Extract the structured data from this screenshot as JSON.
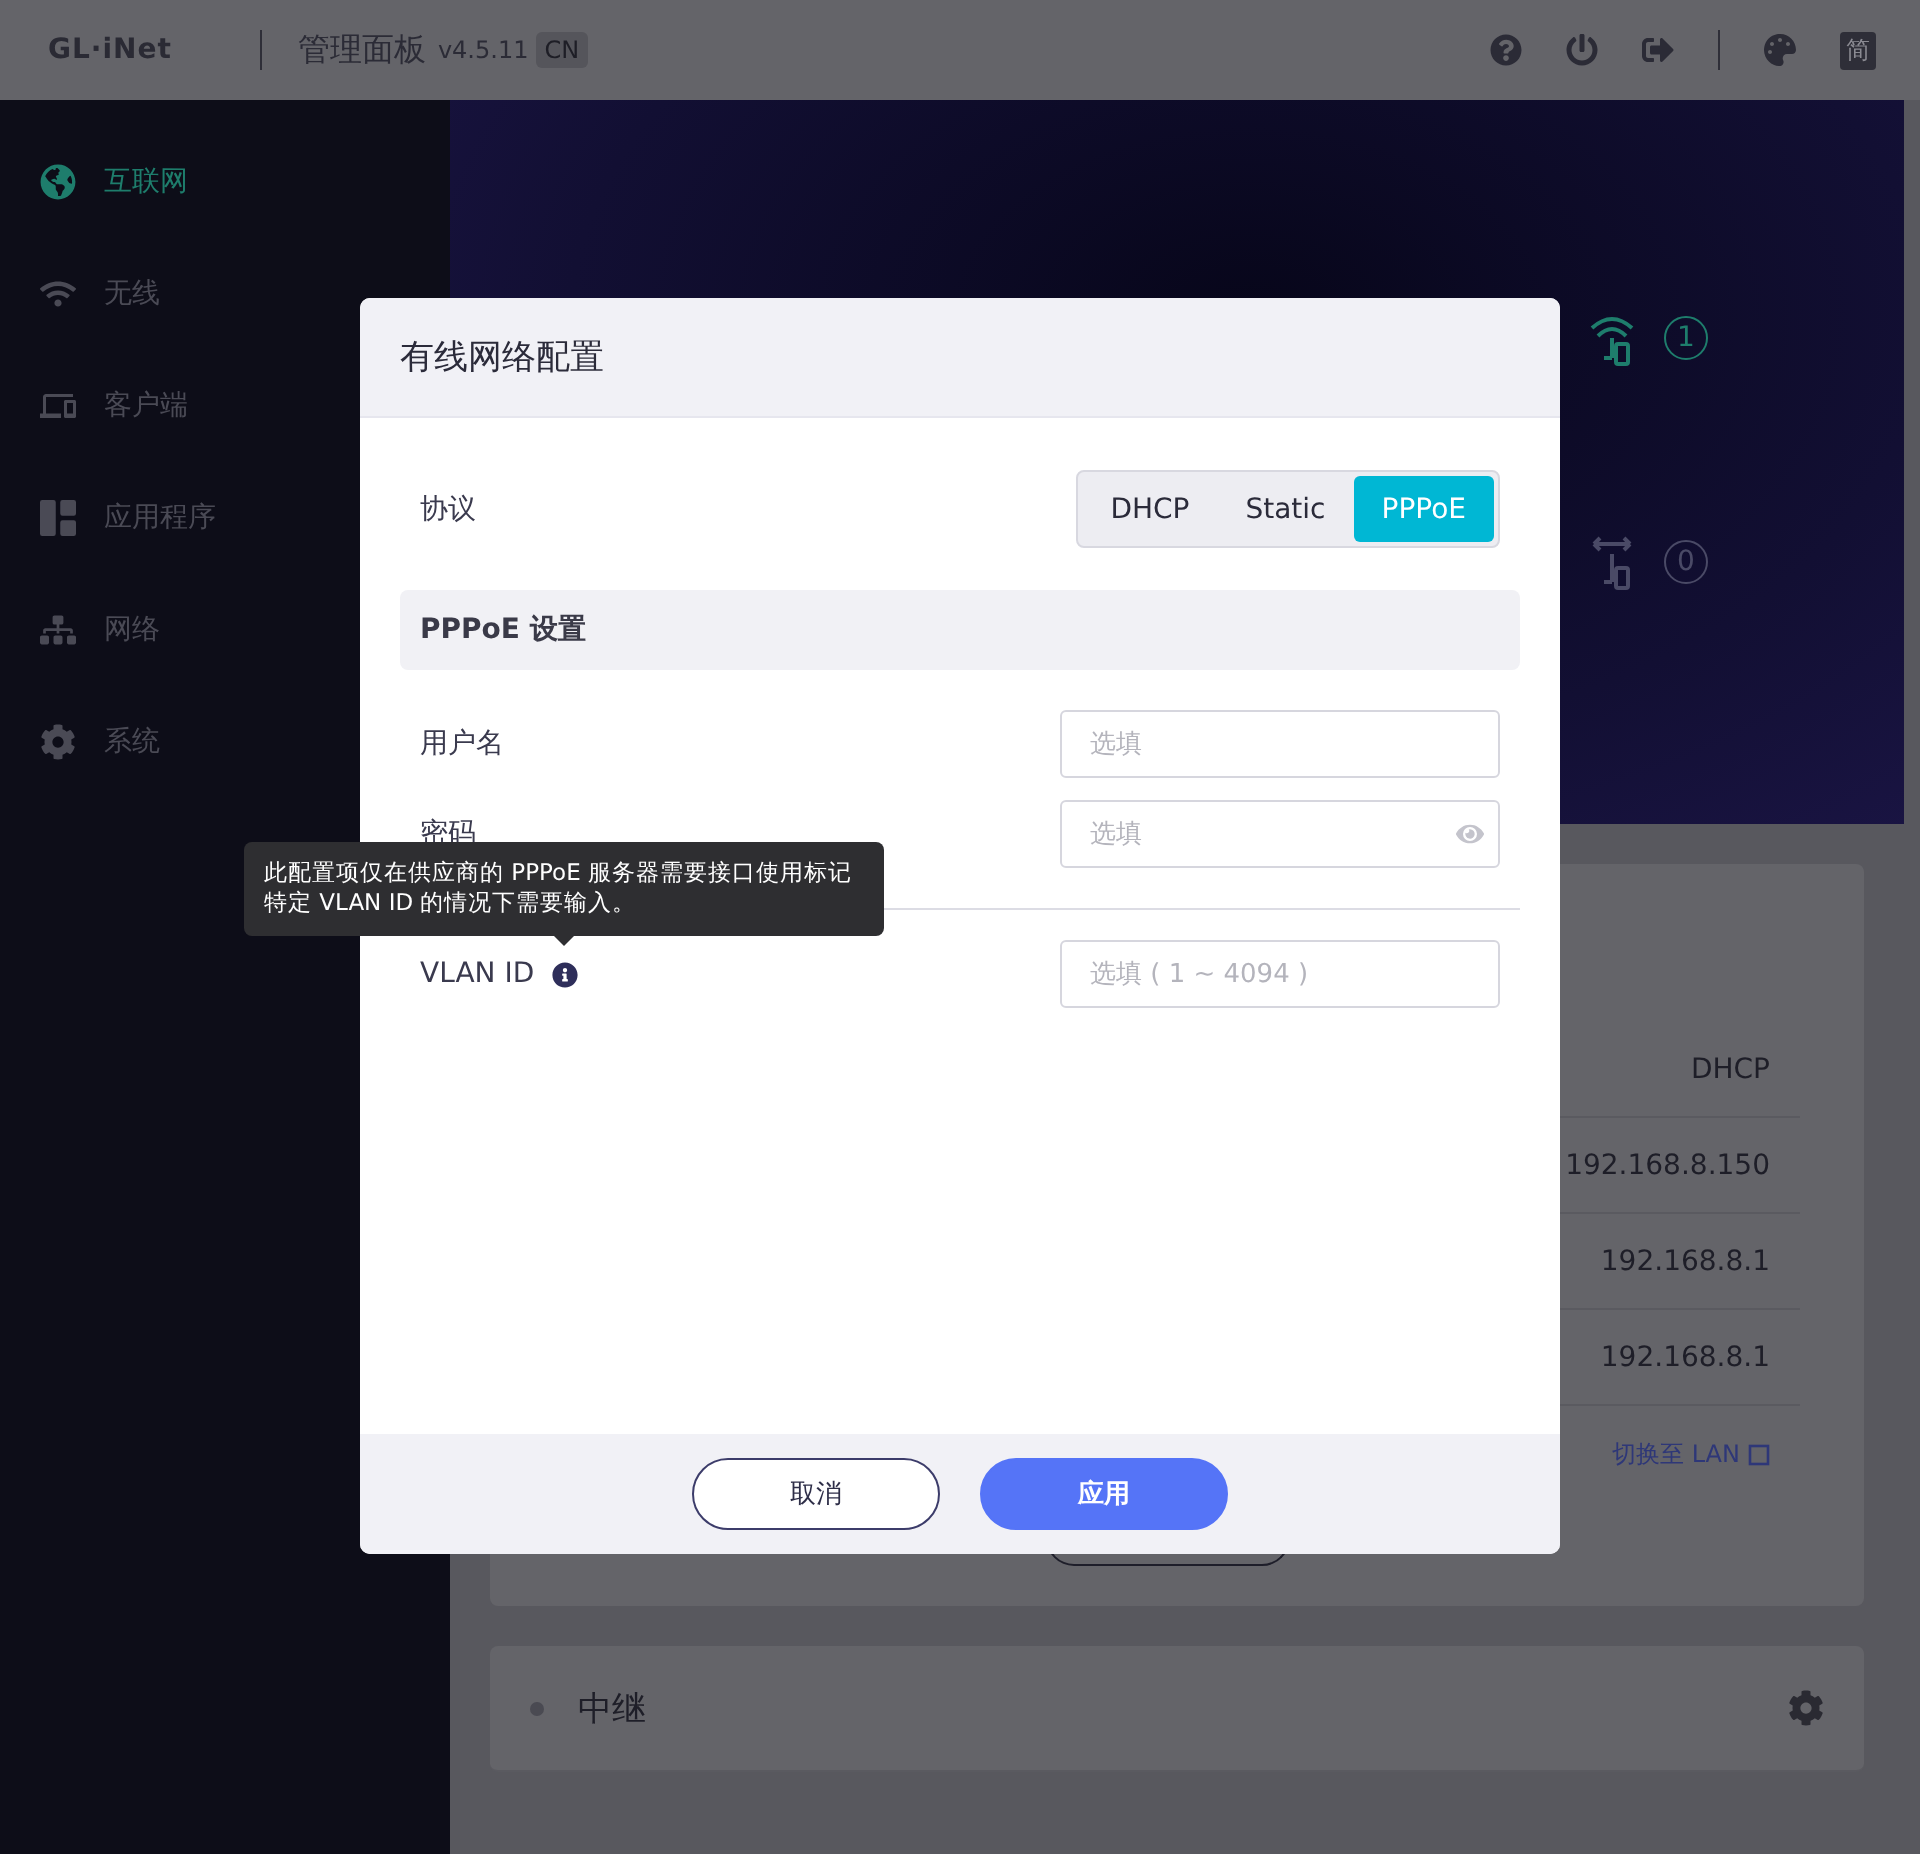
{
  "header": {
    "logo": "GL·iNet",
    "title": "管理面板",
    "version": "v4.5.11",
    "region": "CN",
    "language": "简"
  },
  "sidebar": {
    "items": [
      {
        "label": "互联网",
        "selected": true
      },
      {
        "label": "无线",
        "selected": false
      },
      {
        "label": "客户端",
        "selected": false
      },
      {
        "label": "应用程序",
        "selected": false
      },
      {
        "label": "网络",
        "selected": false
      },
      {
        "label": "系统",
        "selected": false
      }
    ]
  },
  "hero": {
    "counts": [
      {
        "kind": "wireless",
        "value": "1"
      },
      {
        "kind": "wired",
        "value": "0"
      }
    ]
  },
  "card": {
    "values": [
      "DHCP",
      "192.168.8.150",
      "192.168.8.1",
      "192.168.8.1"
    ],
    "link": "切换至 LAN"
  },
  "card2": {
    "title": "中继"
  },
  "dialog": {
    "title": "有线网络配置",
    "protocol_label": "协议",
    "protocols": [
      {
        "label": "DHCP",
        "selected": false
      },
      {
        "label": "Static",
        "selected": false
      },
      {
        "label": "PPPoE",
        "selected": true
      }
    ],
    "section": "PPPoE 设置",
    "fields": [
      {
        "label": "用户名",
        "placeholder": "选填",
        "kind": "text"
      },
      {
        "label": "密码",
        "placeholder": "选填",
        "kind": "password"
      },
      {
        "label": "VLAN ID",
        "placeholder": "选填 ( 1 ~ 4094 )",
        "kind": "info"
      }
    ],
    "tooltip": "此配置项仅在供应商的 PPPoE 服务器需要接口使用标记特定 VLAN ID 的情况下需要输入。",
    "buttons": [
      {
        "label": "取消",
        "kind": "secondary"
      },
      {
        "label": "应用",
        "kind": "primary"
      }
    ]
  }
}
